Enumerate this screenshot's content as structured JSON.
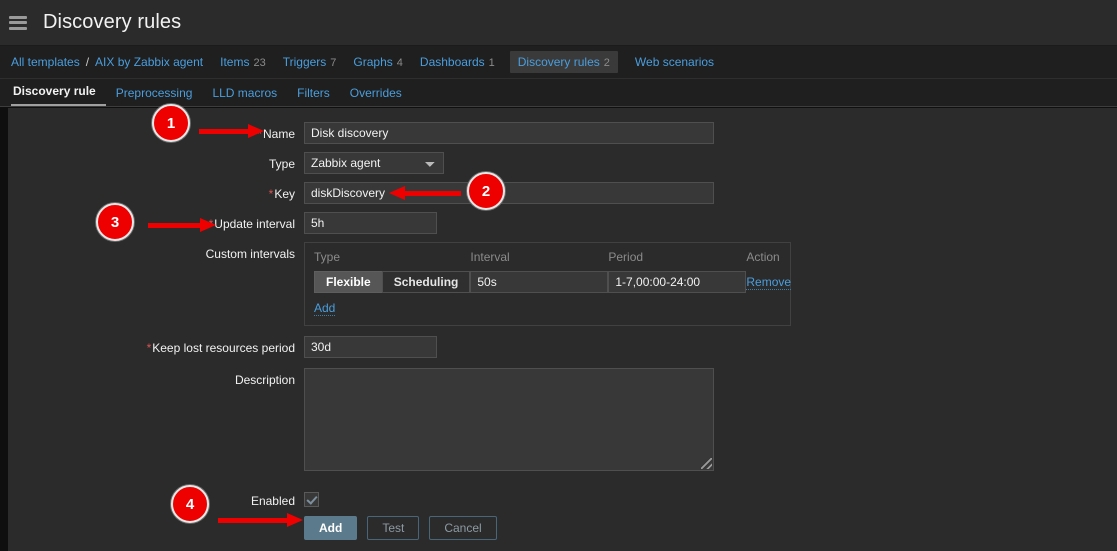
{
  "header": {
    "menu_icon": "hamburger-icon",
    "title": "Discovery rules"
  },
  "breadcrumb": {
    "all_templates": "All templates",
    "separator": "/",
    "template": "AIX by Zabbix agent",
    "items": [
      {
        "label": "Items",
        "count": "23"
      },
      {
        "label": "Triggers",
        "count": "7"
      },
      {
        "label": "Graphs",
        "count": "4"
      },
      {
        "label": "Dashboards",
        "count": "1"
      },
      {
        "label": "Discovery rules",
        "count": "2"
      },
      {
        "label": "Web scenarios",
        "count": ""
      }
    ]
  },
  "tabs": [
    {
      "label": "Discovery rule"
    },
    {
      "label": "Preprocessing"
    },
    {
      "label": "LLD macros"
    },
    {
      "label": "Filters"
    },
    {
      "label": "Overrides"
    }
  ],
  "form": {
    "name": {
      "label": "Name",
      "required": "*",
      "value": "Disk discovery",
      "placeholder": ""
    },
    "type": {
      "label": "Type",
      "value": "Zabbix agent",
      "options": [
        "Zabbix agent"
      ]
    },
    "key": {
      "label": "Key",
      "required": "*",
      "value": "diskDiscovery",
      "placeholder": ""
    },
    "update_interval": {
      "label": "Update interval",
      "required": "*",
      "value": "5h",
      "placeholder": ""
    },
    "custom_intervals": {
      "label": "Custom intervals",
      "columns": [
        "Type",
        "Interval",
        "Period",
        "Action"
      ],
      "rows": [
        {
          "type_flexible": "Flexible",
          "type_scheduling": "Scheduling",
          "selected_type": "Flexible",
          "interval": "50s",
          "period": "1-7,00:00-24:00",
          "action": "Remove"
        }
      ],
      "add_label": "Add"
    },
    "keep_lost": {
      "label": "Keep lost resources period",
      "required": "*",
      "value": "30d",
      "placeholder": ""
    },
    "description": {
      "label": "Description",
      "value": "",
      "placeholder": ""
    },
    "enabled": {
      "label": "Enabled",
      "checked": "true"
    },
    "buttons": {
      "add": "Add",
      "test": "Test",
      "cancel": "Cancel"
    }
  },
  "callouts": [
    {
      "number": "1"
    },
    {
      "number": "2"
    },
    {
      "number": "3"
    },
    {
      "number": "4"
    }
  ],
  "colors": {
    "accent_red": "#ee0000",
    "link_blue": "#4a9ede",
    "required_red": "#d45353",
    "primary_button": "#5b7b8c"
  }
}
